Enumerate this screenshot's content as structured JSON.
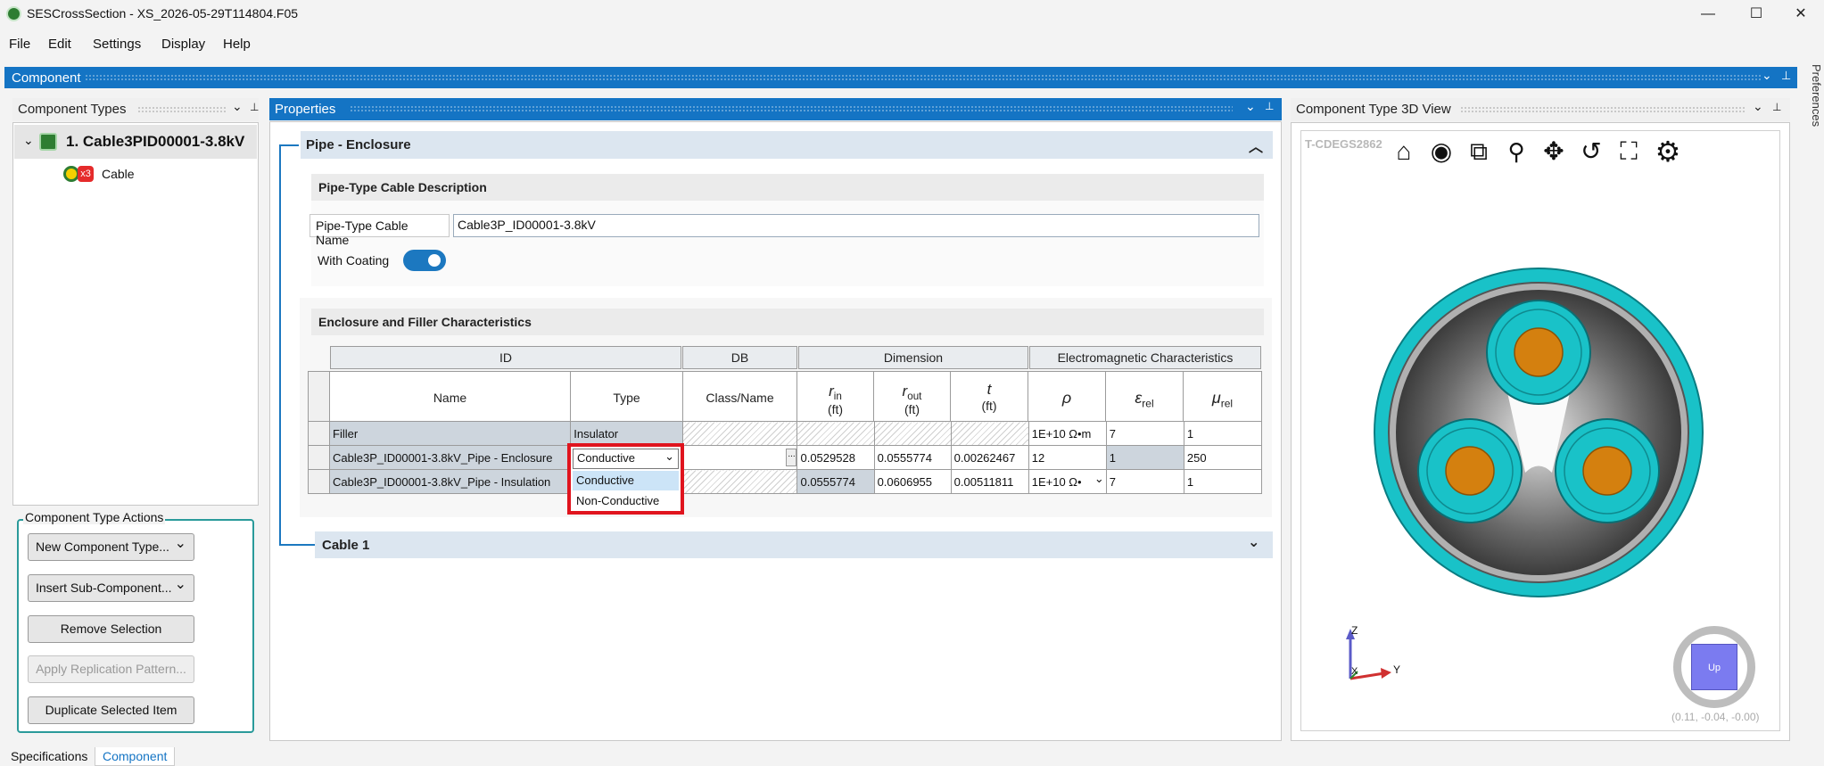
{
  "window": {
    "title": "SESCrossSection - XS_2026-05-29T114804.F05",
    "minimize": "—",
    "maximize": "☐",
    "close": "✕"
  },
  "menu": [
    "File",
    "Edit",
    "Settings",
    "Display",
    "Help"
  ],
  "component_bar": {
    "title": "Component",
    "side_tab": "Preferences"
  },
  "component_types": {
    "title": "Component Types",
    "root": "1. Cable3PID00001-3.8kV",
    "child_badge": "x3",
    "child": "Cable"
  },
  "actions": {
    "title": "Component Type Actions",
    "new_type": "New Component Type...",
    "insert_sub": "Insert Sub-Component...",
    "remove": "Remove Selection",
    "apply_replication": "Apply Replication Pattern...",
    "duplicate": "Duplicate Selected Item"
  },
  "properties": {
    "title": "Properties",
    "section_pipe": "Pipe - Enclosure",
    "desc_header": "Pipe-Type Cable Description",
    "name_label": "Pipe-Type Cable Name",
    "name_value": "Cable3P_ID00001-3.8kV",
    "coating_label": "With Coating",
    "coating_on": true,
    "enc_header": "Enclosure and Filler Characteristics",
    "section_cable": "Cable 1"
  },
  "table": {
    "groups": [
      "ID",
      "DB",
      "Dimension",
      "Electromagnetic Characteristics"
    ],
    "col_name": "Name",
    "col_type": "Type",
    "col_class": "Class/Name",
    "rin_sym": "r",
    "rin_sub": "in",
    "rin_unit": "(ft)",
    "rout_sym": "r",
    "rout_sub": "out",
    "rout_unit": "(ft)",
    "t_sym": "t",
    "t_unit": "(ft)",
    "rho_sym": "ρ",
    "eps_sym": "ε",
    "eps_sub": "rel",
    "mu_sym": "μ",
    "mu_sub": "rel",
    "rows": [
      {
        "name": "Filler",
        "type": "Insulator",
        "rin": "",
        "rout": "",
        "t": "",
        "rho": "1E+10 Ω•m",
        "eps": "7",
        "mu": "1"
      },
      {
        "name": "Cable3P_ID00001-3.8kV_Pipe - Enclosure",
        "type": "Conductive",
        "rin": "0.0529528",
        "rout": "0.0555774",
        "t": "0.00262467",
        "rho": "12",
        "eps": "1",
        "mu": "250"
      },
      {
        "name": "Cable3P_ID00001-3.8kV_Pipe - Insulation",
        "type": "",
        "rin": "0.0555774",
        "rout": "0.0606955",
        "t": "0.00511811",
        "rho": "1E+10 Ω•",
        "eps": "7",
        "mu": "1"
      }
    ],
    "dropdown_options": [
      "Conductive",
      "Non-Conductive"
    ],
    "ellipsis": "..."
  },
  "view3d": {
    "title": "Component Type 3D View",
    "id_label": "T-CDEGS2862",
    "toolbar": [
      "home-icon",
      "eye-icon",
      "zoom-box-icon",
      "zoom-icon",
      "pan-icon",
      "rotate-icon",
      "fit-icon",
      "settings-icon"
    ],
    "axis_z": "Z",
    "axis_x": "X",
    "axis_y": "Y",
    "cube_label": "Up",
    "coords": "(0.11, -0.04, -0.00)",
    "colors": {
      "jacket": "#19c2c8",
      "pipe": "#4a4a4a",
      "conductor": "#d4800f"
    }
  },
  "bottom_tabs": [
    "Specifications",
    "Component"
  ]
}
